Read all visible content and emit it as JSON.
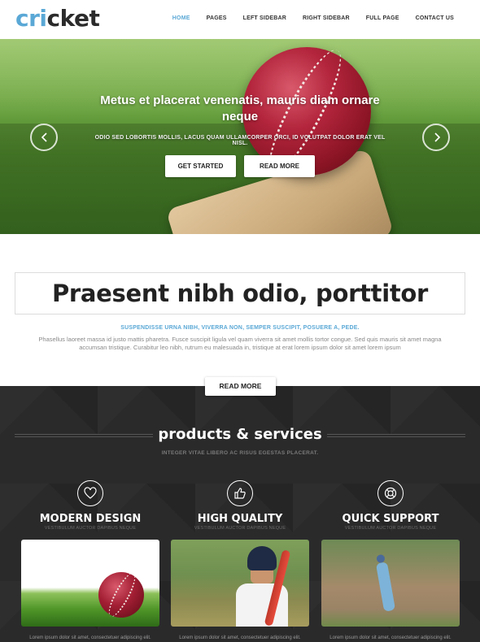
{
  "header": {
    "logo_part1": "cri",
    "logo_part2": "cket",
    "nav": [
      "HOME",
      "PAGES",
      "LEFT SIDEBAR",
      "RIGHT SIDEBAR",
      "FULL PAGE",
      "CONTACT US"
    ],
    "active_nav": "HOME"
  },
  "hero": {
    "title": "Metus et placerat venenatis, mauris diam ornare neque",
    "subtitle": "ODIO SED LOBORTIS MOLLIS, LACUS QUAM ULLAMCORPER ORCI, ID VOLUTPAT DOLOR ERAT VEL NISL.",
    "btn_started": "GET STARTED",
    "btn_readmore": "READ MORE"
  },
  "intro": {
    "title": "Praesent nibh odio, porttitor",
    "subtitle": "SUSPENDISSE URNA NIBH, VIVERRA NON, SEMPER SUSCIPIT, POSUERE A, PEDE.",
    "text": "Phasellus laoreet massa id justo mattis pharetra. Fusce suscipit ligula vel quam viverra sit amet mollis tortor congue. Sed quis mauris sit amet magna accumsan tristique. Curabitur leo nibh, rutrum eu malesuada in, tristique at erat lorem ipsum dolor sit amet lorem ipsum",
    "readmore": "READ MORE"
  },
  "products": {
    "title": "products & services",
    "subtitle": "INTEGER VITAE LIBERO AC RISUS EGESTAS PLACERAT.",
    "features": [
      {
        "title": "MODERN DESIGN",
        "sub": "VESTIBULUM AUCTOR DAPIBUS NEQUE",
        "icon": "heart-icon"
      },
      {
        "title": "HIGH QUALITY",
        "sub": "VESTIBULUM AUCTOR DAPIBUS NEQUE",
        "icon": "thumbs-up-icon"
      },
      {
        "title": "QUICK SUPPORT",
        "sub": "VESTIBULUM AUCTOR DAPIBUS NEQUE",
        "icon": "lifebuoy-icon"
      }
    ],
    "captions": [
      "Lorem ipsum dolor sit amet, consectetuer adipiscing elit.",
      "Lorem ipsum dolor sit amet, consectetuer adipiscing elit.",
      "Lorem ipsum dolor sit amet, consectetuer adipiscing elit."
    ]
  },
  "colors": {
    "accent": "#5aa8d6",
    "dark_bg": "#2a2a2b",
    "text_dark": "#222222"
  }
}
